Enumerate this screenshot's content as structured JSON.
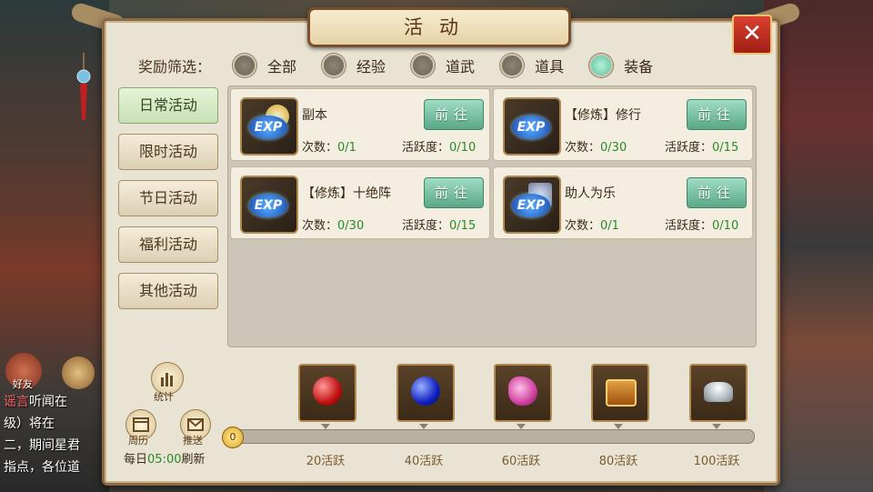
{
  "title": "活动",
  "filter": {
    "label": "奖励筛选：",
    "options": [
      {
        "label": "全部",
        "selected": false
      },
      {
        "label": "经验",
        "selected": false
      },
      {
        "label": "道武",
        "selected": false
      },
      {
        "label": "道具",
        "selected": false
      },
      {
        "label": "装备",
        "selected": true
      }
    ]
  },
  "sidebar": {
    "items": [
      {
        "label": "日常活动",
        "active": true
      },
      {
        "label": "限时活动",
        "active": false
      },
      {
        "label": "节日活动",
        "active": false
      },
      {
        "label": "福利活动",
        "active": false
      },
      {
        "label": "其他活动",
        "active": false
      }
    ]
  },
  "activities": [
    {
      "name": "副本",
      "count_label": "次数：",
      "count": "0/1",
      "active_label": "活跃度：",
      "active": "0/10",
      "button": "前往",
      "icon": "exp-coin-icon"
    },
    {
      "name": "【修炼】修行",
      "count_label": "次数：",
      "count": "0/30",
      "active_label": "活跃度：",
      "active": "0/15",
      "button": "前往",
      "icon": "exp-icon"
    },
    {
      "name": "【修炼】十绝阵",
      "count_label": "次数：",
      "count": "0/30",
      "active_label": "活跃度：",
      "active": "0/15",
      "button": "前往",
      "icon": "exp-icon"
    },
    {
      "name": "助人为乐",
      "count_label": "次数：",
      "count": "0/1",
      "active_label": "活跃度：",
      "active": "0/10",
      "button": "前往",
      "icon": "exp-book-icon"
    }
  ],
  "bottom": {
    "stats_label": "统计",
    "calendar_label": "周历",
    "push_label": "推送",
    "refresh_prefix": "每日",
    "refresh_time": "05:00",
    "refresh_suffix": "刷新",
    "progress_value": "0",
    "progress_fraction": 0
  },
  "rewards": [
    {
      "label": "20活跃",
      "icon": "red-orb-icon"
    },
    {
      "label": "40活跃",
      "icon": "blue-orb-icon"
    },
    {
      "label": "60活跃",
      "icon": "pink-gems-icon"
    },
    {
      "label": "80活跃",
      "icon": "treasure-chest-icon"
    },
    {
      "label": "100活跃",
      "icon": "silver-ingot-icon"
    }
  ],
  "chat": {
    "friend_label": "好友",
    "lines": [
      {
        "tag": "谣言",
        "text": "听闻在"
      },
      {
        "tag": "",
        "text": "级）将在"
      },
      {
        "tag": "",
        "text": "二，期间星君"
      },
      {
        "tag": "",
        "text": "指点，各位道"
      }
    ]
  },
  "colors": {
    "panel_bg": "#e9e3d3",
    "accent_green": "#2a8a2a",
    "button_teal": "#5aa888",
    "close_red": "#c0301f"
  }
}
